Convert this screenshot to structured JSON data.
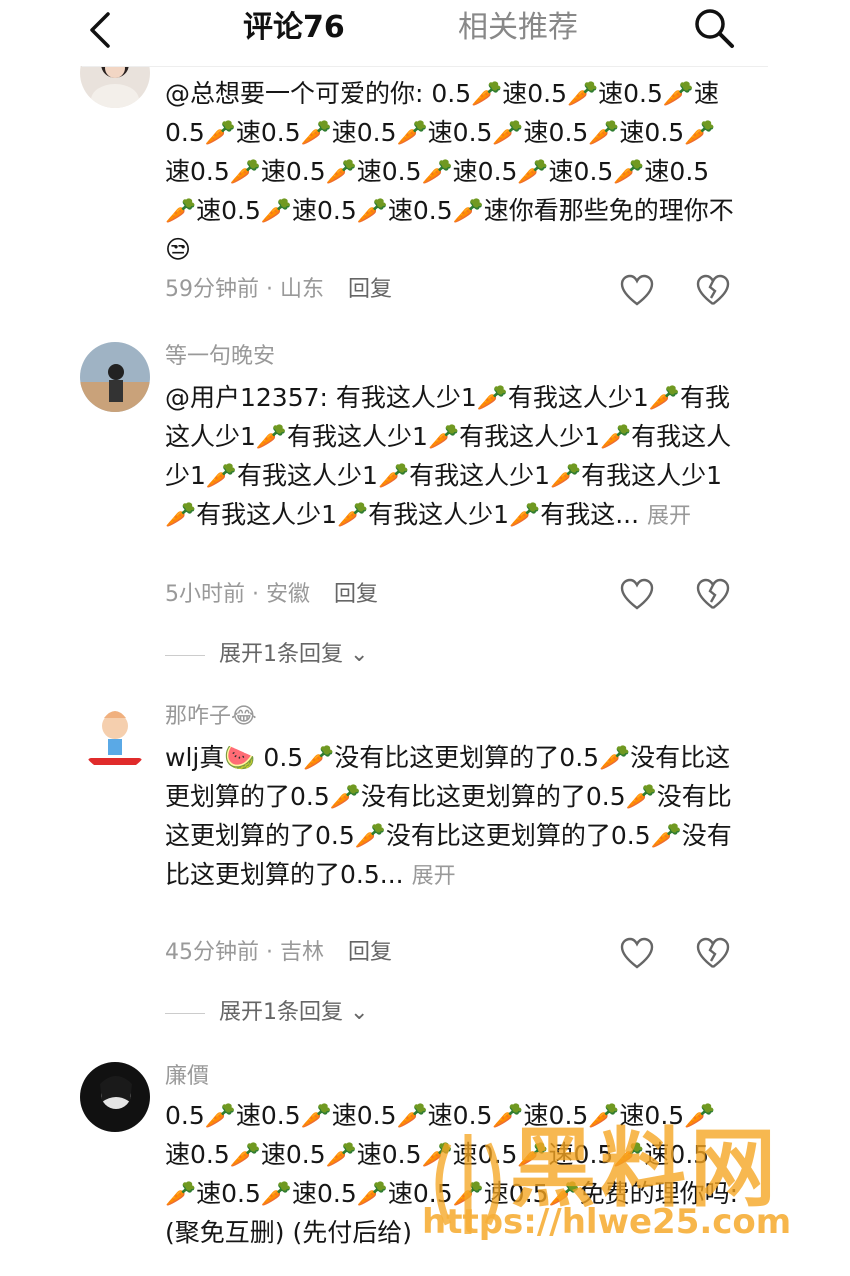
{
  "header": {
    "back_label": "<",
    "tab_comments": "评论76",
    "tab_related": "相关推荐",
    "search_icon": "search-icon"
  },
  "comments": [
    {
      "username": "",
      "text": "@总想要一个可爱的你: 0.5🥕速0.5🥕速0.5🥕速0.5🥕速0.5🥕速0.5🥕速0.5🥕速0.5🥕速0.5🥕速0.5🥕速0.5🥕速0.5🥕速0.5🥕速0.5🥕速0.5🥕速0.5🥕速0.5🥕速0.5🥕速你看那些免的理你不😒",
      "time": "59分钟前 · 山东",
      "reply": "回复"
    },
    {
      "username": "等一句晚安",
      "text": "@用户12357: 有我这人少1🥕有我这人少1🥕有我这人少1🥕有我这人少1🥕有我这人少1🥕有我这人少1🥕有我这人少1🥕有我这人少1🥕有我这人少1🥕有我这人少1🥕有我这人少1🥕有我这...",
      "expand": "展开",
      "time": "5小时前 · 安徽",
      "reply": "回复",
      "more_replies": "展开1条回复"
    },
    {
      "username": "那咋子😂",
      "text": "wlj真🍉 0.5🥕没有比这更划算的了0.5🥕没有比这更划算的了0.5🥕没有比这更划算的了0.5🥕没有比这更划算的了0.5🥕没有比这更划算的了0.5🥕没有比这更划算的了0.5...",
      "expand": "展开",
      "time": "45分钟前 · 吉林",
      "reply": "回复",
      "more_replies": "展开1条回复"
    },
    {
      "username": "廉價",
      "text": "0.5🥕速0.5🥕速0.5🥕速0.5🥕速0.5🥕速0.5🥕速0.5🥕速0.5🥕速0.5🥕速0.5🥕速0.5🥕速0.5🥕速0.5🥕速0.5🥕速0.5🥕速0.5🥕免费的理你吗: (聚免互删) (先付后给)"
    }
  ],
  "watermark": {
    "brand": "黑料网",
    "url": "https://hlwe25.com"
  },
  "colors": {
    "accent_orange": "#f08a24",
    "carrot": "#f26a1b",
    "muted": "#999999"
  }
}
